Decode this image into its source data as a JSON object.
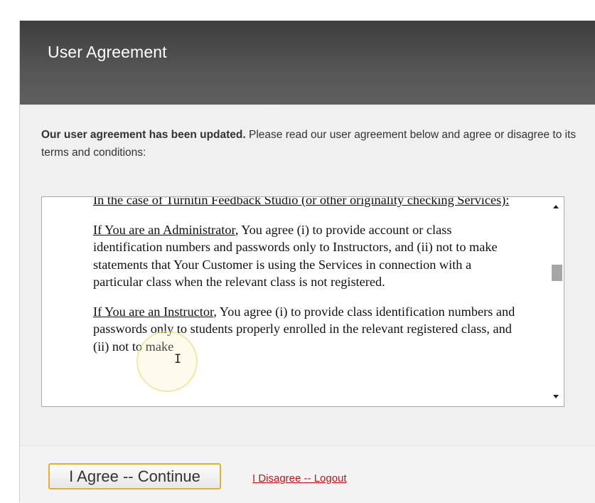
{
  "dialog": {
    "title": "User Agreement",
    "intro_bold": "Our user agreement has been updated.",
    "intro_rest": " Please read our user agreement below and agree or disagree to its terms and conditions:"
  },
  "agreement": {
    "heading": "In the case of Turnitin Feedback Studio (or other originality checking Services):",
    "admin_label": "If You are an Administrator",
    "admin_text": ", You agree (i) to provide account or class identification numbers and passwords only to Instructors, and (ii) not to make statements that Your Customer is using the Services in connection with a particular class when the relevant class is not registered.",
    "instructor_label": "If You are an Instructor",
    "instructor_text": ", You agree (i) to provide class identification numbers and passwords only to students properly enrolled in the relevant registered class, and (ii) not to make"
  },
  "footer": {
    "agree_label": "I Agree -- Continue",
    "disagree_label": "I Disagree -- Logout"
  },
  "colors": {
    "header_bg": "#4a4a4a",
    "agree_border": "#e0b03b",
    "disagree_link": "#c0151b"
  },
  "icons": {
    "scroll_up": "triangle-up",
    "scroll_down": "triangle-down",
    "cursor": "text-ibeam"
  }
}
